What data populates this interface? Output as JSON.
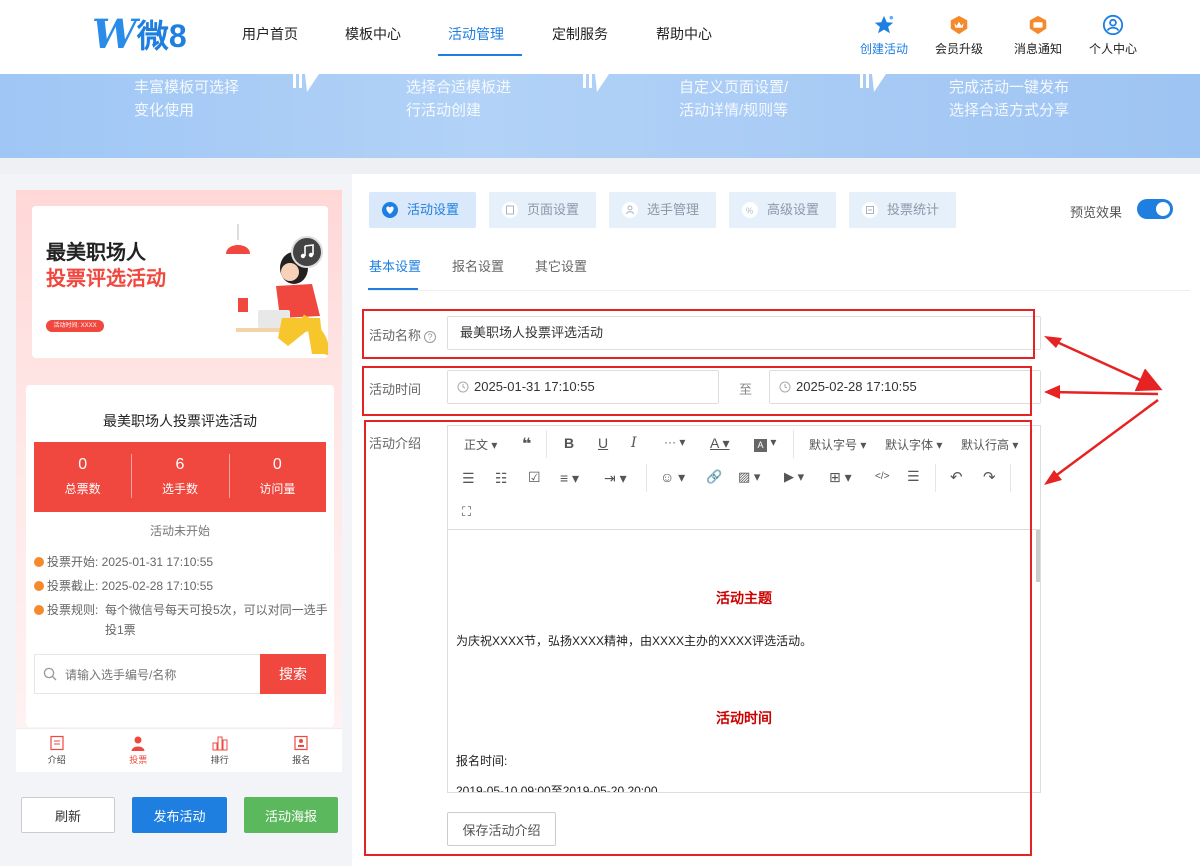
{
  "header": {
    "logo_mark": "W",
    "logo_text": "微8",
    "nav": [
      "用户首页",
      "模板中心",
      "活动管理",
      "定制服务",
      "帮助中心"
    ],
    "right": [
      "创建活动",
      "会员升级",
      "消息通知",
      "个人中心"
    ]
  },
  "banner": {
    "steps": [
      [
        "丰富模板可选择",
        "变化使用"
      ],
      [
        "选择合适模板进",
        "行活动创建"
      ],
      [
        "自定义页面设置/",
        "活动详情/规则等"
      ],
      [
        "完成活动一键发布",
        "选择合适方式分享"
      ]
    ]
  },
  "preview": {
    "poster_line1": "最美职场人",
    "poster_line2": "投票评选活动",
    "poster_pill": "活动时间: XXXX",
    "card_title": "最美职场人投票评选活动",
    "stats": [
      {
        "value": "0",
        "label": "总票数"
      },
      {
        "value": "6",
        "label": "选手数"
      },
      {
        "value": "0",
        "label": "访问量"
      }
    ],
    "status": "活动未开始",
    "vote_start": "投票开始: 2025-01-31 17:10:55",
    "vote_end": "投票截止: 2025-02-28 17:10:55",
    "vote_rule_label": "投票规则:",
    "vote_rule": "每个微信号每天可投5次，可以对同一选手投1票",
    "search_placeholder": "请输入选手编号/名称",
    "search_button": "搜索",
    "tabbar": [
      "介绍",
      "投票",
      "排行",
      "报名"
    ],
    "btn_refresh": "刷新",
    "btn_publish": "发布活动",
    "btn_poster": "活动海报"
  },
  "settings": {
    "main_tabs": [
      "活动设置",
      "页面设置",
      "选手管理",
      "高级设置",
      "投票统计"
    ],
    "preview_label": "预览效果",
    "sub_tabs": [
      "基本设置",
      "报名设置",
      "其它设置"
    ],
    "name_label": "活动名称",
    "name_value": "最美职场人投票评选活动",
    "time_label": "活动时间",
    "time_start": "2025-01-31 17:10:55",
    "time_to": "至",
    "time_end": "2025-02-28 17:10:55",
    "intro_label": "活动介绍",
    "toolbar": {
      "paragraph": "正文",
      "font_size": "默认字号",
      "font_family": "默认字体",
      "line_height": "默认行高"
    },
    "editor": {
      "heading1": "活动主题",
      "para1": "为庆祝XXXX节，弘扬XXXX精神，由XXXX主办的XXXX评选活动。",
      "heading2": "活动时间",
      "para2": "报名时间:",
      "para3": "2019-05-10 09:00至2019-05-20 20:00"
    },
    "save_button": "保存活动介绍"
  }
}
